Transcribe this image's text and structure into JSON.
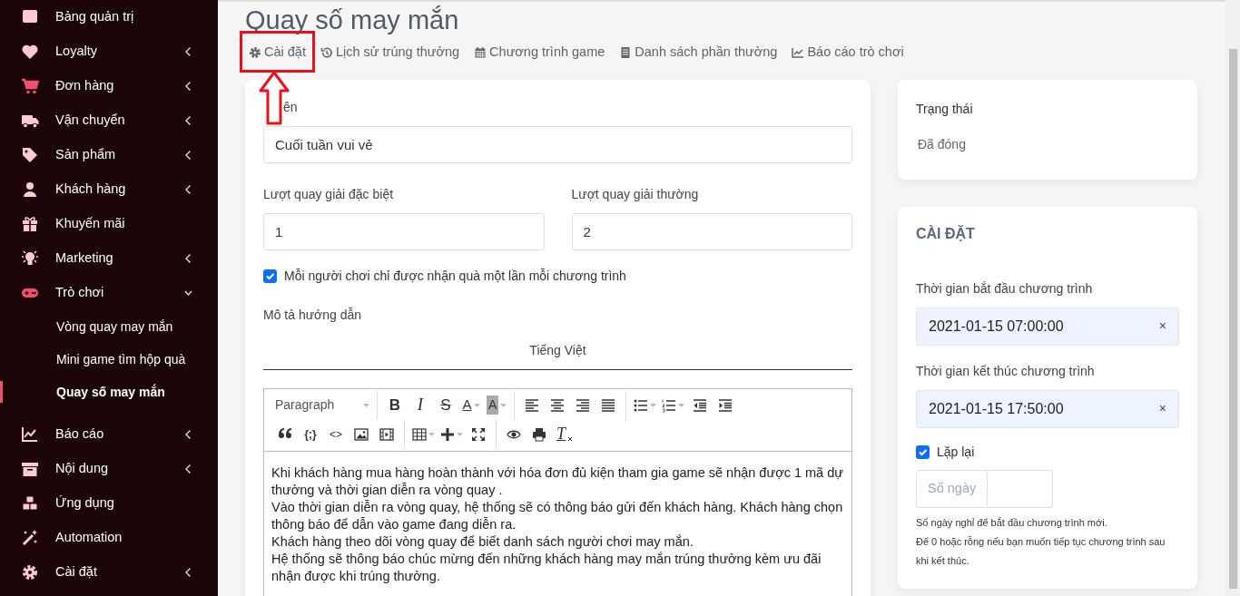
{
  "sidebar": {
    "items": [
      {
        "label": "Bảng quản trị"
      },
      {
        "label": "Loyalty",
        "expanded": false
      },
      {
        "label": "Đơn hàng",
        "expanded": false
      },
      {
        "label": "Vận chuyển",
        "expanded": false
      },
      {
        "label": "Sản phẩm",
        "expanded": false
      },
      {
        "label": "Khách hàng",
        "expanded": false
      },
      {
        "label": "Khuyến mãi"
      },
      {
        "label": "Marketing",
        "expanded": false
      },
      {
        "label": "Trò chơi",
        "expanded": true,
        "children": [
          {
            "label": "Vòng quay may mắn",
            "selected": false
          },
          {
            "label": "Mini game tìm hộp quà",
            "selected": false
          },
          {
            "label": "Quay số may mắn",
            "selected": true
          }
        ]
      },
      {
        "label": "Báo cáo",
        "expanded": false
      },
      {
        "label": "Nội dung",
        "expanded": false
      },
      {
        "label": "Ứng dụng"
      },
      {
        "label": "Automation"
      },
      {
        "label": "Cài đặt",
        "expanded": false
      }
    ]
  },
  "page": {
    "title": "Quay số may mắn",
    "tabs": [
      {
        "label": "Cài đặt",
        "annotated": true
      },
      {
        "label": "Lịch sử trúng thưởng",
        "annotated": false
      },
      {
        "label": "Chương trình game",
        "annotated": false
      },
      {
        "label": "Danh sách phần thưởng",
        "annotated": false
      },
      {
        "label": "Báo cáo trò chơi",
        "annotated": false
      }
    ]
  },
  "form": {
    "name_label": "ên",
    "name_value": "Cuối tuần vui vẻ",
    "special_label": "Lượt quay giải đặc biệt",
    "special_value": "1",
    "normal_label": "Lượt quay giải thường",
    "normal_value": "2",
    "once_checkbox": {
      "label": "Mỗi người chơi chỉ được nhận quà một lần mỗi chương trình",
      "checked": true
    },
    "description_label": "Mô tả hướng dẫn",
    "language_tabs": [
      {
        "label": "Tiếng Việt",
        "selected": true
      }
    ],
    "editor": {
      "rows": [
        [
          [
            {
              "kind": "select",
              "text": "Paragraph",
              "dropdown": true
            }
          ],
          [
            {
              "kind": "bold",
              "text": "B",
              "dropdown": false
            },
            {
              "kind": "italic",
              "text": "I",
              "dropdown": false
            },
            {
              "kind": "strike",
              "text": "S",
              "dropdown": false
            },
            {
              "kind": "fontcolor",
              "text": "A",
              "dropdown": true
            },
            {
              "kind": "backcolor",
              "text": "A",
              "dropdown": true
            }
          ],
          [
            {
              "kind": "alignleft",
              "dropdown": false
            },
            {
              "kind": "aligncenter",
              "dropdown": false
            },
            {
              "kind": "alignright",
              "dropdown": false
            },
            {
              "kind": "justify",
              "dropdown": false
            }
          ],
          [
            {
              "kind": "bullets",
              "dropdown": true
            },
            {
              "kind": "numbers",
              "dropdown": true
            },
            {
              "kind": "outdent",
              "dropdown": false
            },
            {
              "kind": "indent",
              "dropdown": false
            }
          ]
        ],
        [
          [
            {
              "kind": "quote",
              "dropdown": false
            },
            {
              "kind": "code",
              "text": "{;}",
              "dropdown": false
            },
            {
              "kind": "code",
              "text": "<>",
              "dropdown": false
            },
            {
              "kind": "picture",
              "dropdown": false
            },
            {
              "kind": "video",
              "dropdown": false
            }
          ],
          [
            {
              "kind": "table",
              "dropdown": true
            },
            {
              "kind": "plus",
              "dropdown": true
            },
            {
              "kind": "fullscreen",
              "dropdown": false
            }
          ],
          [
            {
              "kind": "preview",
              "dropdown": false
            },
            {
              "kind": "print",
              "dropdown": false
            },
            {
              "kind": "clearformat",
              "text": "T",
              "dropdown": false
            }
          ]
        ]
      ],
      "paragraphs": [
        "Khi khách hàng mua hàng hoàn thành với hóa đơn đủ kiện tham gia game sẽ nhận được 1 mã dự thưởng và thời gian diễn ra vòng quay .",
        "Vào thời gian diễn ra vòng quay, hệ thống sẽ có thông báo gửi đến khách hàng. Khách hàng chọn thông báo để dẫn vào game đang diễn ra.",
        "Khách hàng theo dõi vòng quay để biết danh sách người chơi may mắn.",
        "Hệ thống sẽ thông báo chúc mừng đến những khách hàng may mắn trúng thưởng kèm ưu đãi nhận được khi trúng thưởng."
      ]
    }
  },
  "status_card": {
    "label": "Trạng thái",
    "value": "Đã đóng"
  },
  "settings_card": {
    "title": "CÀI ĐẶT",
    "start_label": "Thời gian bắt đầu chương trình",
    "start_value": "2021-01-15 07:00:00",
    "start_clear": "×",
    "end_label": "Thời gian kết thúc chương trình",
    "end_value": "2021-01-15 17:50:00",
    "end_clear": "×",
    "repeat_checkbox": {
      "label": "Lặp lại",
      "checked": true
    },
    "days_addon": "Số ngày",
    "help": [
      "Số ngày nghỉ để bắt đầu chương trình mới.",
      "Để 0 hoặc rỗng nếu bạn muốn tiếp tục chương trình sau khi kết thúc."
    ]
  }
}
